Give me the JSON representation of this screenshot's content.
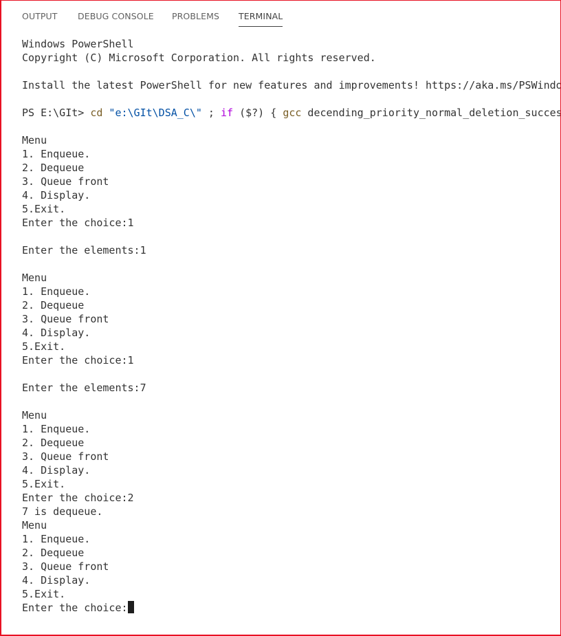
{
  "tabs": [
    {
      "label": "OUTPUT",
      "active": false
    },
    {
      "label": "DEBUG CONSOLE",
      "active": false
    },
    {
      "label": "PROBLEMS",
      "active": false
    },
    {
      "label": "TERMINAL",
      "active": true
    }
  ],
  "terminal": {
    "header": [
      "Windows PowerShell",
      "Copyright (C) Microsoft Corporation. All rights reserved.",
      "",
      "Install the latest PowerShell for new features and improvements! https://aka.ms/PSWindows",
      ""
    ],
    "command": {
      "prompt": "PS E:\\GIt> ",
      "cd": "cd",
      "path": " \"e:\\GIt\\DSA_C\\\"",
      "sep": " ; ",
      "if": "if",
      "cond": " ($?) { ",
      "gcc": "gcc",
      "args": " decending_priority_normal_deletion_success.c -o decending_priority_normal_deletion_success } ; if ($?) { .\\decending_priority_normal_deletion_success }"
    },
    "output": [
      "",
      "Menu",
      "1. Enqueue.",
      "2. Dequeue",
      "3. Queue front",
      "4. Display.",
      "5.Exit.",
      "Enter the choice:1",
      "",
      "Enter the elements:1",
      "",
      "Menu",
      "1. Enqueue.",
      "2. Dequeue",
      "3. Queue front",
      "4. Display.",
      "5.Exit.",
      "Enter the choice:1",
      "",
      "Enter the elements:7",
      "",
      "Menu",
      "1. Enqueue.",
      "2. Dequeue",
      "3. Queue front",
      "4. Display.",
      "5.Exit.",
      "Enter the choice:2",
      "7 is dequeue.",
      "Menu",
      "1. Enqueue.",
      "2. Dequeue",
      "3. Queue front",
      "4. Display.",
      "5.Exit."
    ],
    "last_prompt": "Enter the choice:"
  },
  "colors": {
    "border": "#e81123",
    "tab_text": "#616161",
    "tab_active": "#424242",
    "text": "#333333",
    "string": "#0451a5",
    "keyword": "#af00db",
    "command": "#795e26"
  }
}
